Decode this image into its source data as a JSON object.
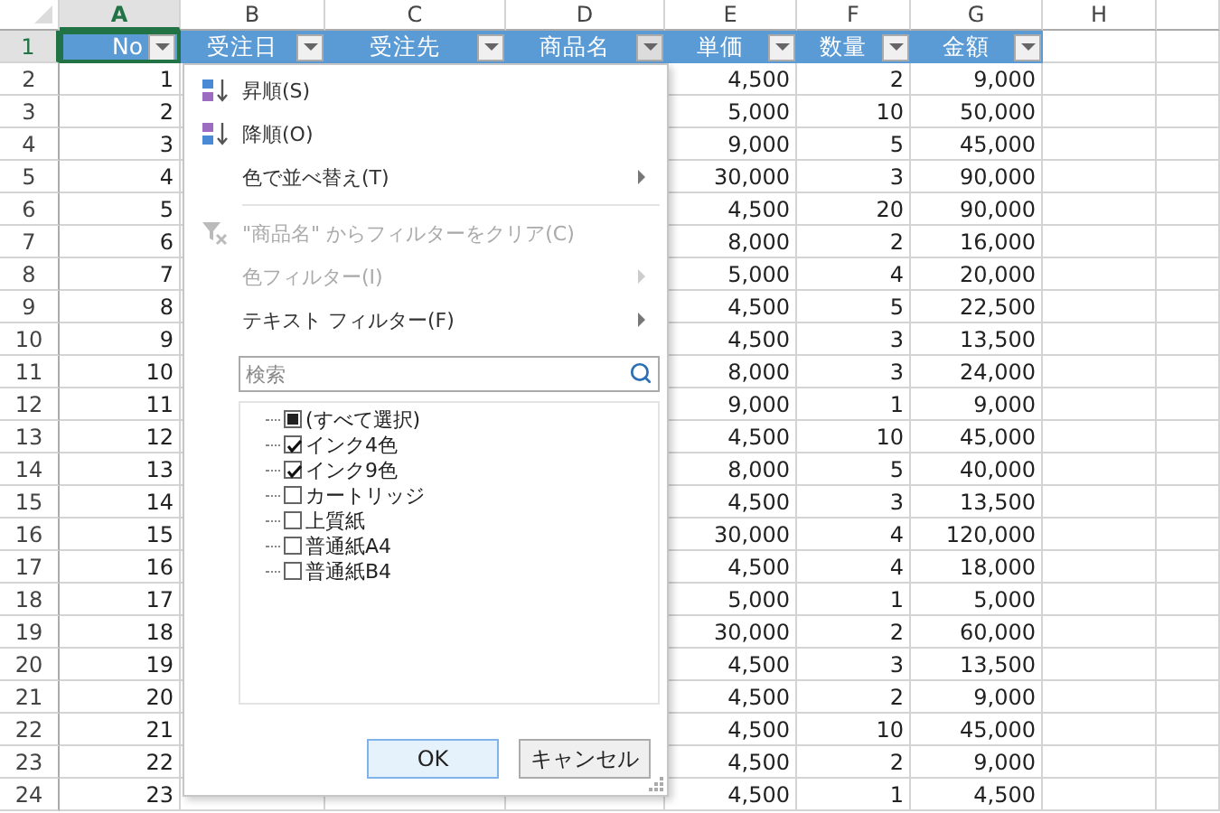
{
  "columns": [
    {
      "letter": "A",
      "selected": true
    },
    {
      "letter": "B",
      "selected": false
    },
    {
      "letter": "C",
      "selected": false
    },
    {
      "letter": "D",
      "selected": false
    },
    {
      "letter": "E",
      "selected": false
    },
    {
      "letter": "F",
      "selected": false
    },
    {
      "letter": "G",
      "selected": false
    },
    {
      "letter": "H",
      "selected": false
    }
  ],
  "header_row": {
    "number": "1",
    "selected": true,
    "cells": [
      {
        "text": "No",
        "filter": true,
        "selected": true
      },
      {
        "text": "受注日",
        "filter": true,
        "selected": false
      },
      {
        "text": "受注先",
        "filter": true,
        "selected": false
      },
      {
        "text": "商品名",
        "filter": true,
        "selected": false
      },
      {
        "text": "単価",
        "filter": true,
        "selected": false
      },
      {
        "text": "数量",
        "filter": true,
        "selected": false
      },
      {
        "text": "金額",
        "filter": true,
        "selected": false
      }
    ]
  },
  "rows": [
    {
      "number": "2",
      "no": "1",
      "price": "4,500",
      "qty": "2",
      "amount": "9,000"
    },
    {
      "number": "3",
      "no": "2",
      "price": "5,000",
      "qty": "10",
      "amount": "50,000"
    },
    {
      "number": "4",
      "no": "3",
      "price": "9,000",
      "qty": "5",
      "amount": "45,000"
    },
    {
      "number": "5",
      "no": "4",
      "price": "30,000",
      "qty": "3",
      "amount": "90,000"
    },
    {
      "number": "6",
      "no": "5",
      "price": "4,500",
      "qty": "20",
      "amount": "90,000"
    },
    {
      "number": "7",
      "no": "6",
      "price": "8,000",
      "qty": "2",
      "amount": "16,000"
    },
    {
      "number": "8",
      "no": "7",
      "price": "5,000",
      "qty": "4",
      "amount": "20,000"
    },
    {
      "number": "9",
      "no": "8",
      "price": "4,500",
      "qty": "5",
      "amount": "22,500"
    },
    {
      "number": "10",
      "no": "9",
      "price": "4,500",
      "qty": "3",
      "amount": "13,500"
    },
    {
      "number": "11",
      "no": "10",
      "price": "8,000",
      "qty": "3",
      "amount": "24,000"
    },
    {
      "number": "12",
      "no": "11",
      "price": "9,000",
      "qty": "1",
      "amount": "9,000"
    },
    {
      "number": "13",
      "no": "12",
      "price": "4,500",
      "qty": "10",
      "amount": "45,000"
    },
    {
      "number": "14",
      "no": "13",
      "price": "8,000",
      "qty": "5",
      "amount": "40,000"
    },
    {
      "number": "15",
      "no": "14",
      "price": "4,500",
      "qty": "3",
      "amount": "13,500"
    },
    {
      "number": "16",
      "no": "15",
      "price": "30,000",
      "qty": "4",
      "amount": "120,000"
    },
    {
      "number": "17",
      "no": "16",
      "price": "4,500",
      "qty": "4",
      "amount": "18,000"
    },
    {
      "number": "18",
      "no": "17",
      "price": "5,000",
      "qty": "1",
      "amount": "5,000"
    },
    {
      "number": "19",
      "no": "18",
      "price": "30,000",
      "qty": "2",
      "amount": "60,000"
    },
    {
      "number": "20",
      "no": "19",
      "price": "4,500",
      "qty": "3",
      "amount": "13,500"
    },
    {
      "number": "21",
      "no": "20",
      "price": "4,500",
      "qty": "2",
      "amount": "9,000"
    },
    {
      "number": "22",
      "no": "21",
      "price": "4,500",
      "qty": "10",
      "amount": "45,000"
    },
    {
      "number": "23",
      "no": "22",
      "price": "4,500",
      "qty": "2",
      "amount": "9,000"
    },
    {
      "number": "24",
      "no": "23",
      "price": "4,500",
      "qty": "1",
      "amount": "4,500"
    }
  ],
  "filter_menu": {
    "items": [
      {
        "kind": "sort_asc",
        "label": "昇順(S)",
        "disabled": false,
        "submenu": false
      },
      {
        "kind": "sort_desc",
        "label": "降順(O)",
        "disabled": false,
        "submenu": false
      },
      {
        "kind": "plain",
        "label": "色で並べ替え(T)",
        "disabled": false,
        "submenu": true
      },
      {
        "kind": "clear",
        "label": "\"商品名\" からフィルターをクリア(C)",
        "disabled": true,
        "submenu": false
      },
      {
        "kind": "plain",
        "label": "色フィルター(I)",
        "disabled": true,
        "submenu": true
      },
      {
        "kind": "plain",
        "label": "テキスト フィルター(F)",
        "disabled": false,
        "submenu": true
      }
    ],
    "search": {
      "placeholder": "検索"
    },
    "values": [
      {
        "label": "(すべて選択)",
        "checked": false,
        "partial": true
      },
      {
        "label": "インク4色",
        "checked": true,
        "partial": false
      },
      {
        "label": "インク9色",
        "checked": true,
        "partial": false
      },
      {
        "label": "カートリッジ",
        "checked": false,
        "partial": false
      },
      {
        "label": "上質紙",
        "checked": false,
        "partial": false
      },
      {
        "label": "普通紙A4",
        "checked": false,
        "partial": false
      },
      {
        "label": "普通紙B4",
        "checked": false,
        "partial": false
      }
    ],
    "buttons": [
      {
        "label": "OK",
        "default": true
      },
      {
        "label": "キャンセル",
        "default": false
      }
    ]
  }
}
